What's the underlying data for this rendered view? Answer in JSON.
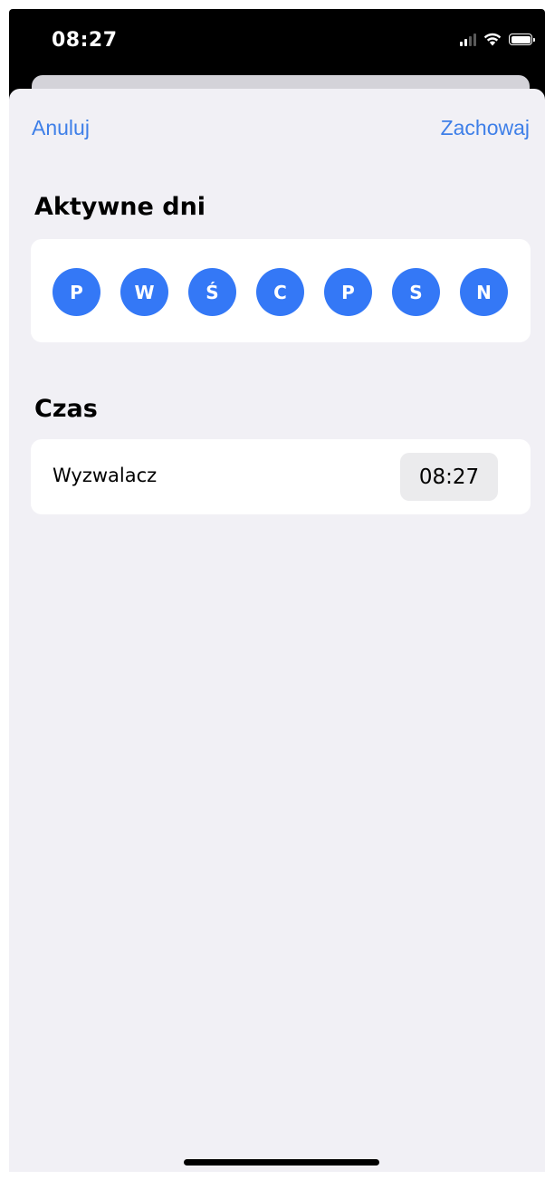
{
  "status_bar": {
    "time": "08:27",
    "icons": [
      "cellular-signal-icon",
      "wifi-icon",
      "battery-icon"
    ]
  },
  "nav": {
    "cancel_label": "Anuluj",
    "save_label": "Zachowaj"
  },
  "active_days": {
    "title": "Aktywne dni",
    "days": [
      "P",
      "W",
      "Ś",
      "C",
      "P",
      "S",
      "N"
    ]
  },
  "time_section": {
    "title": "Czas",
    "trigger_label": "Wyzwalacz",
    "trigger_value": "08:27"
  },
  "colors": {
    "accent": "#3478f6",
    "nav_link": "#3e7fe8",
    "sheet_background": "#f1f0f5",
    "card_background": "#ffffff",
    "time_pill_background": "#ebebed"
  }
}
